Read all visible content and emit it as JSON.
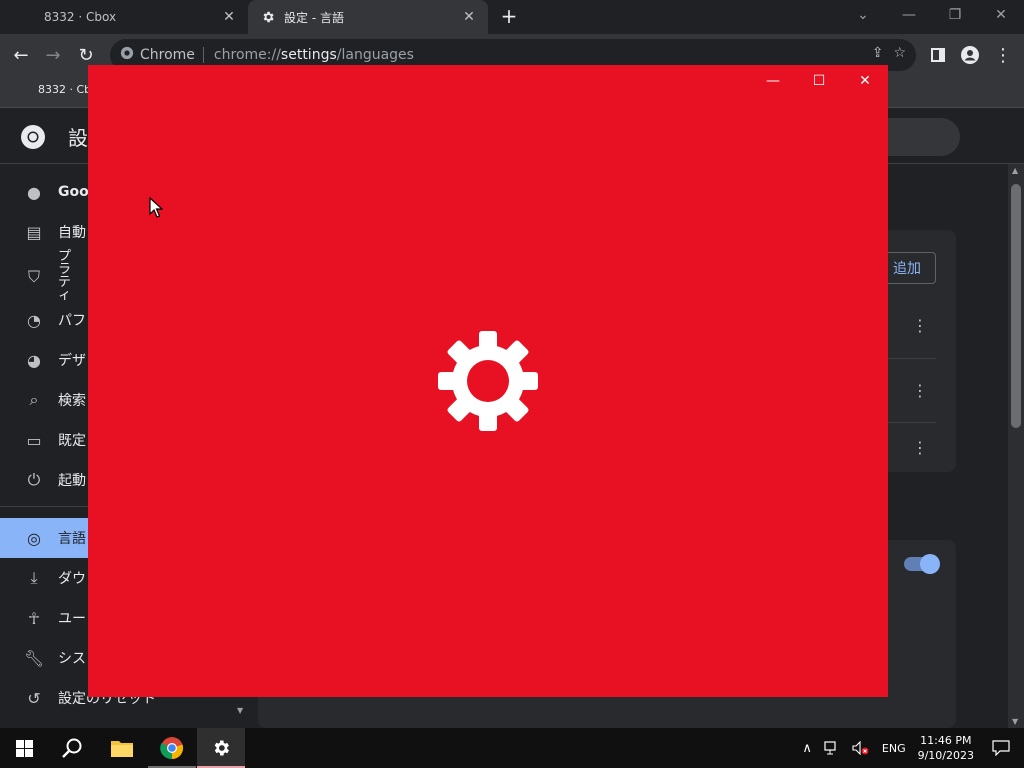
{
  "browser": {
    "tabs": [
      {
        "title": "8332 · Cbox",
        "close": "✕"
      },
      {
        "title": "設定 - 言語",
        "close": "✕"
      }
    ],
    "new_tab": "+",
    "omnibox": {
      "site_label": "Chrome",
      "url_scheme": "chrome://",
      "url_host": "settings",
      "url_path": "/languages"
    },
    "bookmark": "8332 · Cb"
  },
  "settings": {
    "title": "設",
    "nav": [
      {
        "label": "Goo",
        "icon": "person-icon"
      },
      {
        "label": "自動",
        "icon": "clipboard-icon"
      },
      {
        "label": "プラ ティ",
        "icon": "shield-icon"
      },
      {
        "label": "パフ",
        "icon": "speedometer-icon"
      },
      {
        "label": "デザ",
        "icon": "palette-icon"
      },
      {
        "label": "検索",
        "icon": "search-icon"
      },
      {
        "label": "既定",
        "icon": "browser-icon"
      },
      {
        "label": "起動",
        "icon": "power-icon"
      },
      {
        "label": "言語",
        "icon": "globe-icon"
      },
      {
        "label": "ダウ",
        "icon": "download-icon"
      },
      {
        "label": "ユー",
        "icon": "accessibility-icon"
      },
      {
        "label": "シス",
        "icon": "wrench-icon"
      },
      {
        "label": "設定のリセット",
        "icon": "reset-icon"
      }
    ],
    "add_language": "追加"
  },
  "splash": {
    "background": "#e81123",
    "minimize": "—",
    "maximize": "☐",
    "close": "✕"
  },
  "taskbar": {
    "language": "ENG",
    "time": "11:46 PM",
    "date": "9/10/2023"
  }
}
